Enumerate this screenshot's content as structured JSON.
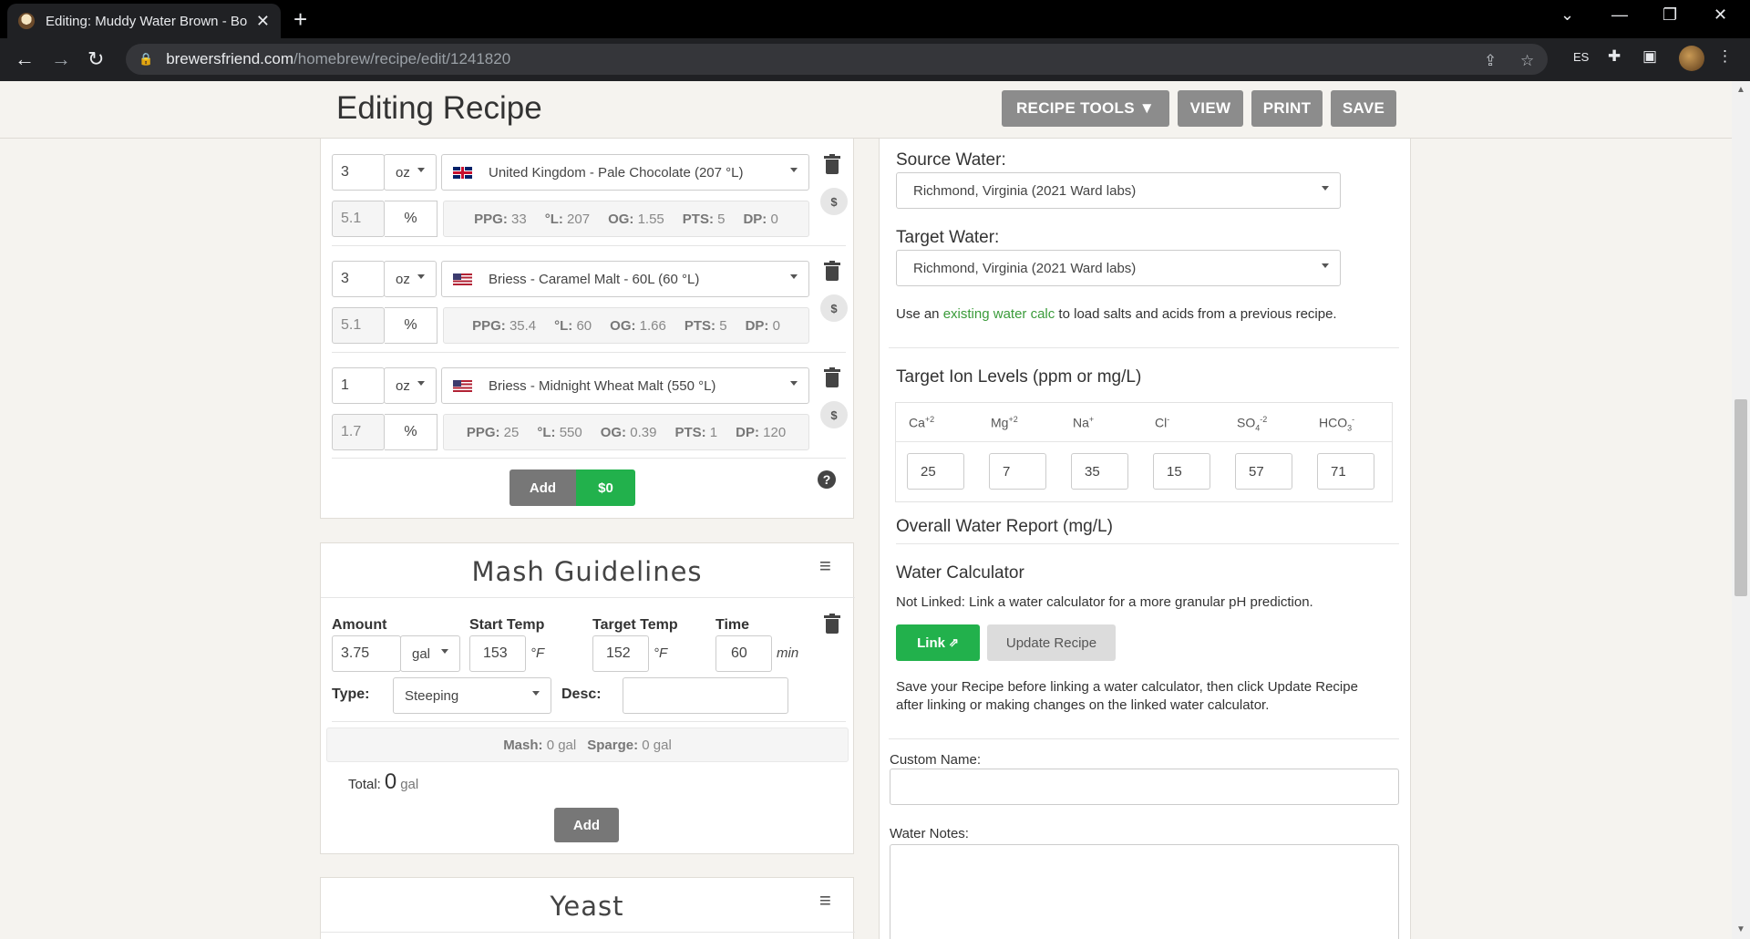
{
  "browser": {
    "tab_title": "Editing: Muddy Water Brown - Bo",
    "url_host": "brewersfriend.com",
    "url_path": "/homebrew/recipe/edit/1241820",
    "ext_label": "ES"
  },
  "header": {
    "title": "Editing Recipe",
    "recipe_tools_label": "RECIPE TOOLS ▼",
    "view_label": "VIEW",
    "print_label": "PRINT",
    "save_label": "SAVE"
  },
  "fermentables": [
    {
      "amount": "3",
      "unit": "oz",
      "flag": "uk",
      "name": "United Kingdom - Pale Chocolate (207 °L)",
      "percent": "5.1",
      "percent_sign": "%",
      "ppg_label": "PPG:",
      "ppg": "33",
      "l_label": "°L:",
      "l": "207",
      "og_label": "OG:",
      "og": "1.55",
      "pts_label": "PTS:",
      "pts": "5",
      "dp_label": "DP:",
      "dp": "0"
    },
    {
      "amount": "3",
      "unit": "oz",
      "flag": "us",
      "name": "Briess - Caramel Malt - 60L (60 °L)",
      "percent": "5.1",
      "percent_sign": "%",
      "ppg_label": "PPG:",
      "ppg": "35.4",
      "l_label": "°L:",
      "l": "60",
      "og_label": "OG:",
      "og": "1.66",
      "pts_label": "PTS:",
      "pts": "5",
      "dp_label": "DP:",
      "dp": "0"
    },
    {
      "amount": "1",
      "unit": "oz",
      "flag": "us",
      "name": "Briess - Midnight Wheat Malt (550 °L)",
      "percent": "1.7",
      "percent_sign": "%",
      "ppg_label": "PPG:",
      "ppg": "25",
      "l_label": "°L:",
      "l": "550",
      "og_label": "OG:",
      "og": "0.39",
      "pts_label": "PTS:",
      "pts": "1",
      "dp_label": "DP:",
      "dp": "120"
    }
  ],
  "fermentables_footer": {
    "add_label": "Add",
    "cost_label": "$0",
    "help": "?",
    "dollar": "$"
  },
  "mash": {
    "title": "Mash Guidelines",
    "amount_label": "Amount",
    "amount": "3.75",
    "amount_unit": "gal",
    "start_temp_label": "Start Temp",
    "start_temp": "153",
    "target_temp_label": "Target Temp",
    "target_temp": "152",
    "temp_unit": "°F",
    "time_label": "Time",
    "time": "60",
    "time_unit": "min",
    "type_label": "Type:",
    "type_value": "Steeping",
    "desc_label": "Desc:",
    "desc_value": "",
    "mash_label": "Mash:",
    "mash_value": "0 gal",
    "sparge_label": "Sparge:",
    "sparge_value": "0 gal",
    "total_label": "Total:",
    "total_value": "0",
    "total_unit": "gal",
    "add_label": "Add"
  },
  "yeast": {
    "title": "Yeast"
  },
  "water": {
    "source_label": "Source Water:",
    "source_value": "Richmond, Virginia (2021 Ward labs)",
    "target_label": "Target Water:",
    "target_value": "Richmond, Virginia (2021 Ward labs)",
    "hint_prefix": "Use an ",
    "hint_link": "existing water calc",
    "hint_suffix": " to load salts and acids from a previous recipe.",
    "ion_heading": "Target Ion Levels (ppm or mg/L)",
    "ions": [
      {
        "base": "Ca",
        "sup": "+2",
        "sub": "",
        "sup2": "",
        "value": "25"
      },
      {
        "base": "Mg",
        "sup": "+2",
        "sub": "",
        "sup2": "",
        "value": "7"
      },
      {
        "base": "Na",
        "sup": "+",
        "sub": "",
        "sup2": "",
        "value": "35"
      },
      {
        "base": "Cl",
        "sup": "-",
        "sub": "",
        "sup2": "",
        "value": "15"
      },
      {
        "base": "SO",
        "sup": "",
        "sub": "4",
        "sup2": "-2",
        "value": "57"
      },
      {
        "base": "HCO",
        "sup": "",
        "sub": "3",
        "sup2": "-",
        "value": "71"
      }
    ],
    "report_heading": "Overall Water Report (mg/L)",
    "calc_heading": "Water Calculator",
    "calc_status": "Not Linked: Link a water calculator for a more granular pH prediction.",
    "link_label": "Link",
    "update_label": "Update Recipe",
    "save_note_1": "Save your Recipe before linking a water calculator, then click Update Recipe",
    "save_note_2": "after linking or making changes on the linked water calculator.",
    "custom_name_label": "Custom Name:",
    "custom_name_value": "",
    "notes_label": "Water Notes:",
    "notes_value": ""
  },
  "colors": {
    "accent_green": "#22b14c",
    "button_gray": "#8c8c8c",
    "link_green": "#3a9b3a"
  }
}
